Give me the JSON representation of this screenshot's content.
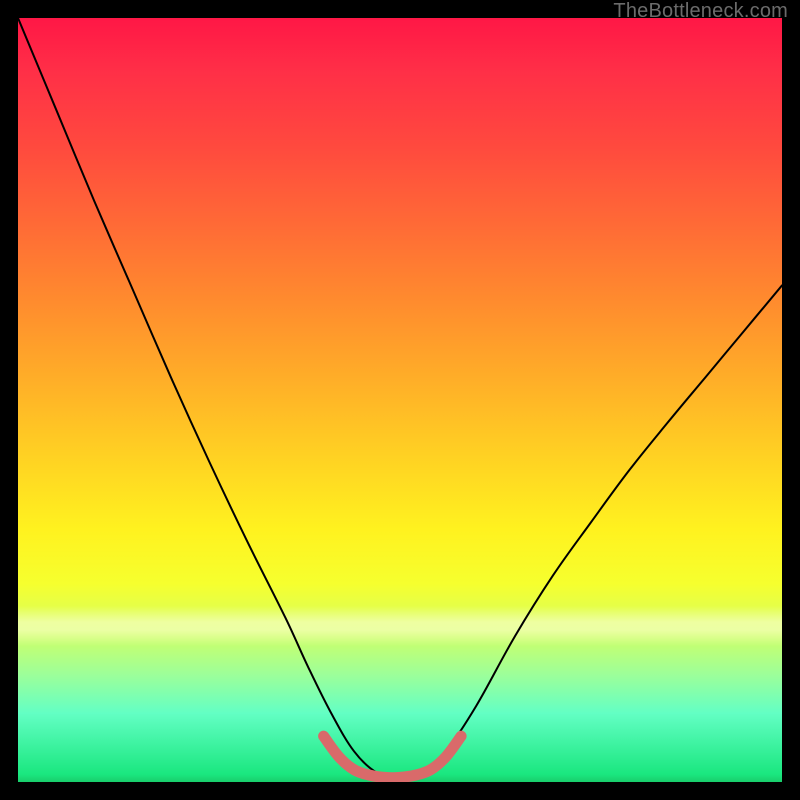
{
  "watermark": "TheBottleneck.com",
  "colors": {
    "frame": "#000000",
    "curve": "#000000",
    "bottom_marker": "#d96a6a"
  },
  "chart_data": {
    "type": "line",
    "title": "",
    "xlabel": "",
    "ylabel": "",
    "xlim": [
      0,
      100
    ],
    "ylim": [
      0,
      100
    ],
    "grid": false,
    "legend": false,
    "series": [
      {
        "name": "black-curve",
        "color": "#000000",
        "x": [
          0,
          5,
          10,
          15,
          20,
          25,
          30,
          35,
          38,
          41,
          44,
          47,
          50,
          53,
          56,
          60,
          65,
          70,
          75,
          80,
          85,
          90,
          95,
          100
        ],
        "y": [
          100,
          88,
          76,
          64.5,
          53,
          42,
          31.5,
          21.5,
          15,
          9,
          4,
          1.2,
          0.5,
          1.2,
          4,
          10,
          19,
          27,
          34,
          40.8,
          47,
          53,
          59,
          65
        ]
      },
      {
        "name": "bottom-highlight",
        "color": "#d96a6a",
        "x": [
          40,
          42,
          44,
          46,
          48,
          50,
          52,
          54,
          56,
          58
        ],
        "y": [
          6,
          3.3,
          1.6,
          0.9,
          0.6,
          0.6,
          0.9,
          1.6,
          3.3,
          6
        ]
      }
    ],
    "background_gradient_stops": [
      {
        "pos": 0.0,
        "color": "#ff1746"
      },
      {
        "pos": 0.17,
        "color": "#ff4a3e"
      },
      {
        "pos": 0.37,
        "color": "#ff8b2e"
      },
      {
        "pos": 0.57,
        "color": "#ffd023"
      },
      {
        "pos": 0.74,
        "color": "#f6ff2e"
      },
      {
        "pos": 0.86,
        "color": "#9cff9a"
      },
      {
        "pos": 1.0,
        "color": "#1ae77f"
      }
    ]
  }
}
